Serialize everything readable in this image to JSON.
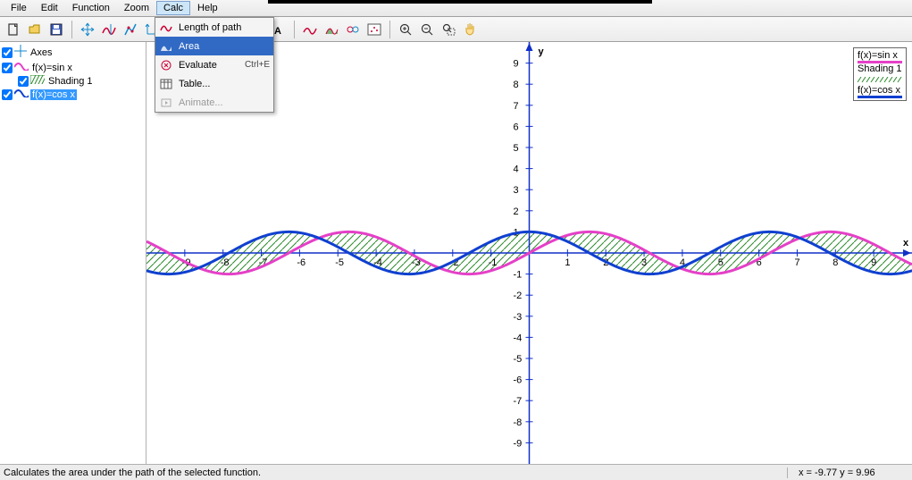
{
  "menus": [
    "File",
    "Edit",
    "Function",
    "Zoom",
    "Calc",
    "Help"
  ],
  "open_menu_index": 4,
  "dropdown": {
    "items": [
      {
        "label": "Length of path",
        "icon": "path-icon",
        "shortcut": ""
      },
      {
        "label": "Area",
        "icon": "area-icon",
        "shortcut": "",
        "highlight": true
      },
      {
        "label": "Evaluate",
        "icon": "evaluate-icon",
        "shortcut": "Ctrl+E"
      },
      {
        "label": "Table...",
        "icon": "table-icon",
        "shortcut": ""
      },
      {
        "label": "Animate...",
        "icon": "animate-icon",
        "shortcut": "",
        "disabled": true
      }
    ]
  },
  "tree": [
    {
      "label": "Axes",
      "icon": "axes",
      "checked": true,
      "selected": false,
      "indent": false
    },
    {
      "label": "f(x)=sin x",
      "icon": "sine-pink",
      "checked": true,
      "selected": false,
      "indent": false
    },
    {
      "label": "Shading 1",
      "icon": "hatch",
      "checked": true,
      "selected": false,
      "indent": true
    },
    {
      "label": "f(x)=cos x",
      "icon": "sine-blue",
      "checked": true,
      "selected": true,
      "indent": false
    }
  ],
  "legend": [
    {
      "label": "f(x)=sin x",
      "type": "line",
      "color": "#e540c8"
    },
    {
      "label": "Shading 1",
      "type": "hatch",
      "color": "#2a8a2a"
    },
    {
      "label": "f(x)=cos x",
      "type": "line",
      "color": "#1040d0"
    }
  ],
  "status": {
    "message": "Calculates the area under the path of the selected function.",
    "coords": "x = -9.77   y = 9.96"
  },
  "chart_data": {
    "type": "line",
    "xlabel": "x",
    "ylabel": "y",
    "xlim": [
      -10,
      10
    ],
    "ylim": [
      -10,
      10
    ],
    "x_ticks": [
      -9,
      -8,
      -7,
      -6,
      -5,
      -4,
      -3,
      -2,
      -1,
      1,
      2,
      3,
      4,
      5,
      6,
      7,
      8,
      9
    ],
    "y_ticks": [
      -9,
      -8,
      -7,
      -6,
      -5,
      -4,
      -3,
      -2,
      -1,
      1,
      2,
      3,
      4,
      5,
      6,
      7,
      8,
      9
    ],
    "series": [
      {
        "name": "f(x)=sin x",
        "color": "#e540c8",
        "width": 3,
        "expr": "sin(x)"
      },
      {
        "name": "f(x)=cos x",
        "color": "#1040d0",
        "width": 3,
        "expr": "cos(x)"
      }
    ],
    "shading": {
      "name": "Shading 1",
      "between": [
        "sin(x)",
        "cos(x)"
      ],
      "fill": "hatch-green"
    }
  },
  "toolbar_icons": [
    "new",
    "open",
    "save",
    "|",
    "axes-move",
    "trace",
    "fit",
    "axes-tool",
    "|",
    "path",
    "area",
    "evaluate",
    "table",
    "|",
    "text",
    "|",
    "insert-func",
    "shade",
    "relation",
    "series",
    "|",
    "zoom-in",
    "zoom-out",
    "zoom-window",
    "pan"
  ]
}
